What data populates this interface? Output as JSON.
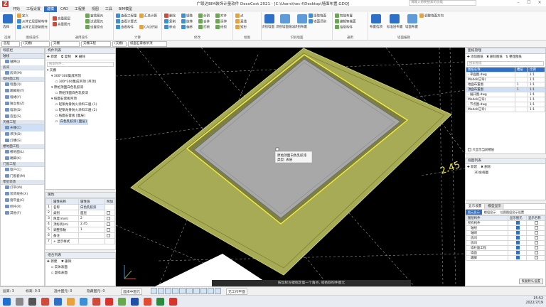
{
  "window": {
    "title": "广联达BIM装饰计量软件 DecoCost 2021 - [C:\\Users\\hec-f\\Desktop\\墙面布置.GDQ]",
    "search_placeholder": "请输入想要搜索的功能"
  },
  "menu": {
    "items": [
      "开始",
      "工程设置",
      "建模",
      "CAD",
      "工程量",
      "视图",
      "工具",
      "BIM模型"
    ],
    "active": 2
  },
  "ribbon": {
    "select_group": {
      "big": "选择",
      "label": "选择"
    },
    "cad_group": {
      "rows": [
        "定义",
        "从其它层复制构件",
        "从其它层复制图元",
        "高量图层",
        "高量图元"
      ],
      "label": "图纸操作"
    },
    "common_group": {
      "rows": [
        "查找图元",
        "过滤图元",
        "设置原点",
        "云检查",
        "锁定",
        "解锁",
        "二次编辑"
      ],
      "label": "通用操作"
    },
    "calc_group": {
      "rows": [
        "查看工程量",
        "查看计算式",
        "查看构件",
        "汇总计算",
        "CAD识别"
      ],
      "label": "计算"
    },
    "modify_group": {
      "rows": [
        "删除",
        "复制",
        "移动",
        "镜像",
        "旋转",
        "偏移",
        "分割",
        "合并",
        "打断",
        "对齐",
        "延伸",
        "修剪"
      ],
      "label": "修改"
    },
    "draw_group": {
      "rows": [
        "点",
        "直线",
        "矩形",
        "智能布置",
        "识别"
      ],
      "label": "绘图"
    },
    "identify_group": {
      "items": [
        "识别墙面",
        "识别墙面做法",
        "识别布置",
        "墙面识别",
        "提取墙面",
        "识别吊顶图层"
      ],
      "label": "识别墙面"
    },
    "smart_group": {
      "items": [
        "智能布置",
        "布置选项",
        "编辑智能面",
        "拾取构件",
        "工具栏"
      ],
      "label": "通用"
    },
    "right_group": {
      "items": [
        "布置选项",
        "标准层布置",
        "墙面布置",
        "调整墙面方向"
      ],
      "label": "墙面编辑"
    }
  },
  "toolbar2": {
    "floor": "首层",
    "category": "(天棚)",
    "type": "天棚",
    "layer": "天棚工程",
    "sub": "(天棚)",
    "detail": "纸面石膏板吊顶"
  },
  "nav": {
    "title": "导航栏",
    "sections": [
      {
        "name": "轴线",
        "items": [
          {
            "label": "轴网(J)"
          }
        ]
      },
      {
        "name": "房间",
        "items": [
          {
            "label": "房间(M)"
          }
        ]
      },
      {
        "name": "墙柱面工程",
        "items": [
          {
            "label": "墙面(Q)"
          },
          {
            "label": "踢脚线(T)"
          },
          {
            "label": "墙裙(Y)"
          },
          {
            "label": "独立柱(Z)"
          },
          {
            "label": "墙洞(D)"
          },
          {
            "label": "造型(S)"
          }
        ]
      },
      {
        "name": "天棚工程",
        "items": [
          {
            "label": "天棚(C)"
          },
          {
            "label": "吊顶(D)"
          },
          {
            "label": "灯槽(G)"
          }
        ]
      },
      {
        "name": "楼地面工程",
        "items": [
          {
            "label": "楼地面(L)"
          },
          {
            "label": "踢脚(K)"
          }
        ]
      },
      {
        "name": "门窗工程",
        "items": [
          {
            "label": "窗户(C)"
          },
          {
            "label": "门窗套(M)"
          }
        ]
      },
      {
        "name": "零星装饰",
        "items": [
          {
            "label": "灯带(W)"
          },
          {
            "label": "装饰线条(X)"
          },
          {
            "label": "窗帘盒(C)"
          },
          {
            "label": "栏杆(R)"
          },
          {
            "label": "其他(F)"
          }
        ]
      }
    ],
    "selected": "天棚(C)"
  },
  "component_list": {
    "title": "构件列表",
    "buttons": [
      "新建",
      "复制",
      "删除"
    ],
    "search_placeholder": "搜索构件...",
    "tree": [
      {
        "level": 0,
        "label": "天棚"
      },
      {
        "level": 1,
        "label": "300*300集成吊顶"
      },
      {
        "level": 2,
        "label": "300*300集成吊顶 [吊顶]"
      },
      {
        "level": 1,
        "label": "原始顶面白色乳胶漆"
      },
      {
        "level": 2,
        "label": "原始顶面白色乳胶漆"
      },
      {
        "level": 1,
        "label": "纸面石膏板吊顶"
      },
      {
        "level": 2,
        "label": "轻钢龙骨防火涂料三遍 (1)"
      },
      {
        "level": 2,
        "label": "轻钢龙骨防火涂料三遍 (2)"
      },
      {
        "level": 2,
        "label": "纸面石膏板 [面层]"
      },
      {
        "level": 2,
        "label": "白色乳胶漆 [面层]"
      }
    ],
    "selected_index": 9
  },
  "properties": {
    "title": "属性",
    "headers": [
      "属性名称",
      "属性值",
      "附加"
    ],
    "rows": [
      {
        "no": "1",
        "name": "名称",
        "value": "白色乳胶漆"
      },
      {
        "no": "2",
        "name": "类别",
        "value": "面层"
      },
      {
        "no": "3",
        "name": "厚度(mm)",
        "value": "2"
      },
      {
        "no": "4",
        "name": "顶标高(m)",
        "value": "2.45"
      },
      {
        "no": "5",
        "name": "调整系数",
        "value": "1"
      },
      {
        "no": "6",
        "name": "备注",
        "value": ""
      },
      {
        "no": "7",
        "name": "+ 显示样式",
        "value": ""
      }
    ]
  },
  "assembly": {
    "title": "组合列表",
    "buttons": [
      "新建",
      "删除"
    ],
    "items": [
      "实体表面",
      "虚拟表面"
    ]
  },
  "viewport": {
    "tooltip_line1": "原始顶面白色乳胶漆",
    "tooltip_line2": "类型: 表层",
    "hint": "按鼠标左键指定第一个角点, 或拾取构件图元",
    "dim_label": "2.45"
  },
  "drawings": {
    "title": "图纸管理",
    "buttons": [
      "添加图纸",
      "删除图纸",
      "整理图纸"
    ],
    "search_placeholder": "搜索图纸",
    "headers": [
      "图纸名称",
      "楼层",
      "比例"
    ],
    "rows": [
      {
        "name": "- 平面图.dwg",
        "floor": "",
        "scale": "1:1"
      },
      {
        "name": "  Model(已导)",
        "floor": "",
        "scale": "1:1"
      },
      {
        "name": "    地面布置图",
        "floor": "1",
        "scale": "1:1"
      },
      {
        "name": "    顶面布置图",
        "floor": "1",
        "scale": "1:1"
      },
      {
        "name": "- 展开图.dwg",
        "floor": "",
        "scale": "1:1"
      },
      {
        "name": "  Model(已导)",
        "floor": "",
        "scale": "1:1"
      },
      {
        "name": "- 节点图.dwg",
        "floor": "",
        "scale": "1:1"
      },
      {
        "name": "  Model(已导)",
        "floor": "",
        "scale": "1:1"
      }
    ],
    "only_current": "只显示当前楼层"
  },
  "views": {
    "title": "视图列表",
    "buttons": [
      "新建",
      "删除"
    ],
    "items": [
      "3D总视图"
    ]
  },
  "display": {
    "tabs": [
      "显示设置",
      "模型显示"
    ],
    "subtabs": [
      "图元显示",
      "楼层显示",
      "位图图层显示设置"
    ],
    "headers": [
      "图层构件",
      "显示图元",
      "显示名称"
    ],
    "rows": [
      {
        "name": "所有构件",
        "a": true,
        "b": false
      },
      {
        "name": "轴线",
        "a": true,
        "b": false
      },
      {
        "name": "轴网",
        "a": true,
        "b": false
      },
      {
        "name": "房间",
        "a": true,
        "b": false
      },
      {
        "name": "房间",
        "a": true,
        "b": false
      },
      {
        "name": "墙柱面工程",
        "a": true,
        "b": false
      },
      {
        "name": "墙面",
        "a": true,
        "b": false
      },
      {
        "name": "踢脚",
        "a": true,
        "b": false
      }
    ],
    "reset": "恢复默认设置"
  },
  "status": {
    "floor_height": "层高: 3",
    "base_height": "标高: 0-3",
    "selected": "选中图元: 0",
    "hidden": "隐藏图元: 0",
    "snap": "选择中图元",
    "mode": "无工作平面",
    "coords": ""
  },
  "clock": {
    "time": "15:52",
    "date": "2022/7/19"
  },
  "colors": {
    "accent": "#2f6fc7",
    "slab": "#a7ab55",
    "ceiling": "#a8a8a8",
    "highlight": "#f5ec3a"
  }
}
